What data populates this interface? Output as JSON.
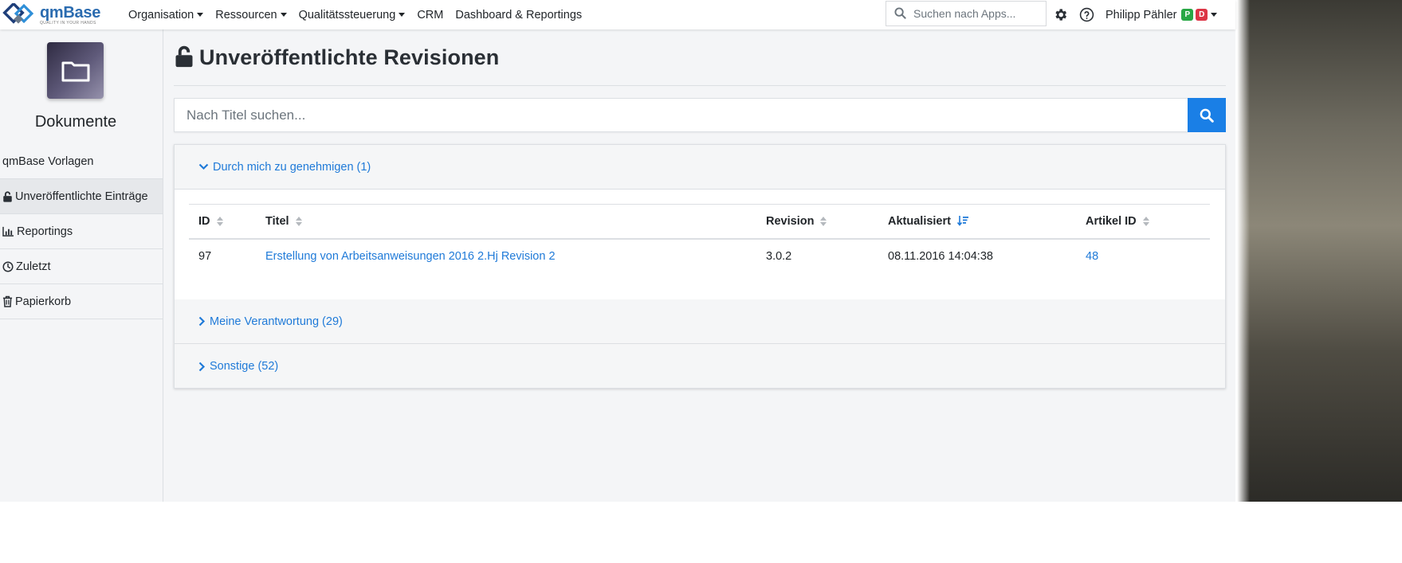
{
  "brand": {
    "name": "qmBase",
    "tagline": "QUALITY IN YOUR HANDS"
  },
  "nav": {
    "items": [
      {
        "label": "Organisation",
        "dropdown": true
      },
      {
        "label": "Ressourcen",
        "dropdown": true
      },
      {
        "label": "Qualitätssteuerung",
        "dropdown": true
      },
      {
        "label": "CRM",
        "dropdown": false
      },
      {
        "label": "Dashboard & Reportings",
        "dropdown": false
      }
    ],
    "app_search_placeholder": "Suchen nach Apps...",
    "settings_icon": "gear-icon",
    "help_icon": "question-circle-icon",
    "user": {
      "name": "Philipp Pähler",
      "badge1": "P",
      "badge2": "D"
    }
  },
  "sidebar": {
    "title": "Dokumente",
    "items": [
      {
        "label": "qmBase Vorlagen",
        "icon": ""
      },
      {
        "label": "Unveröffentlichte Einträge",
        "icon": "lock-open-icon"
      },
      {
        "label": "Reportings",
        "icon": "bar-chart-icon"
      },
      {
        "label": "Zuletzt",
        "icon": "clock-icon"
      },
      {
        "label": "Papierkorb",
        "icon": "trash-icon"
      }
    ]
  },
  "page": {
    "title": "Unveröffentlichte Revisionen",
    "search_placeholder": "Nach Titel suchen..."
  },
  "sections": {
    "approve": {
      "label": "Durch mich zu genehmigen (1)",
      "columns": [
        "ID",
        "Titel",
        "Revision",
        "Aktualisiert",
        "Artikel ID"
      ],
      "rows": [
        {
          "id": "97",
          "title": "Erstellung von Arbeitsanweisungen 2016 2.Hj Revision 2",
          "revision": "3.0.2",
          "updated": "08.11.2016 14:04:38",
          "article_id": "48"
        }
      ]
    },
    "responsibility": {
      "label": "Meine Verantwortung (29)"
    },
    "other": {
      "label": "Sonstige (52)"
    }
  },
  "colors": {
    "accent": "#1f7ad8",
    "search_button": "#1a7fe6",
    "badge_green": "#28a745",
    "badge_red": "#dc3545"
  }
}
